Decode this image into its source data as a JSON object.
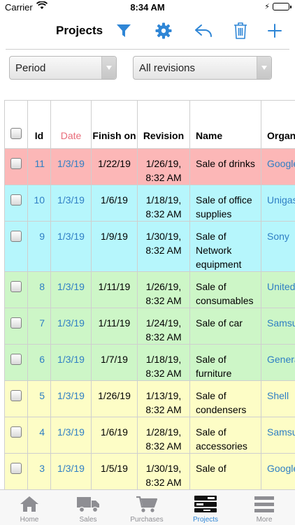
{
  "status": {
    "carrier": "Carrier",
    "time": "8:34 AM"
  },
  "nav": {
    "title": "Projects"
  },
  "filters": {
    "period": "Period",
    "revisions": "All revisions"
  },
  "table": {
    "headers": {
      "id": "Id",
      "date": "Date",
      "finish": "Finish on",
      "revision": "Revision",
      "name": "Name",
      "organization": "Organ"
    },
    "rows": [
      {
        "id": "11",
        "date": "1/3/19",
        "finish": "1/22/19",
        "revision": "1/26/19, 8:32 AM",
        "name": "Sale of drinks",
        "organization": "Google",
        "color": "#fcb7b7"
      },
      {
        "id": "10",
        "date": "1/3/19",
        "finish": "1/6/19",
        "revision": "1/18/19, 8:32 AM",
        "name": "Sale of office supplies",
        "organization": "Unigas",
        "color": "#b6f6fc"
      },
      {
        "id": "9",
        "date": "1/3/19",
        "finish": "1/9/19",
        "revision": "1/30/19, 8:32 AM",
        "name": "Sale of Network equipment",
        "organization": "Sony",
        "color": "#b6f6fc"
      },
      {
        "id": "8",
        "date": "1/3/19",
        "finish": "1/11/19",
        "revision": "1/26/19, 8:32 AM",
        "name": "Sale of consumables",
        "organization": "United",
        "color": "#cdf6c7"
      },
      {
        "id": "7",
        "date": "1/3/19",
        "finish": "1/11/19",
        "revision": "1/24/19, 8:32 AM",
        "name": "Sale of car",
        "organization": "Samsu",
        "color": "#cdf6c7"
      },
      {
        "id": "6",
        "date": "1/3/19",
        "finish": "1/7/19",
        "revision": "1/18/19, 8:32 AM",
        "name": "Sale of furniture",
        "organization": "General motors",
        "color": "#cdf6c7"
      },
      {
        "id": "5",
        "date": "1/3/19",
        "finish": "1/26/19",
        "revision": "1/13/19, 8:32 AM",
        "name": "Sale of condensers",
        "organization": "Shell",
        "color": "#fdfdc6"
      },
      {
        "id": "4",
        "date": "1/3/19",
        "finish": "1/6/19",
        "revision": "1/28/19, 8:32 AM",
        "name": "Sale of accessories",
        "organization": "Samsu",
        "color": "#fdfdc6"
      },
      {
        "id": "3",
        "date": "1/3/19",
        "finish": "1/5/19",
        "revision": "1/30/19, 8:32 AM",
        "name": "Sale of",
        "organization": "Google",
        "color": "#fdfdc6"
      }
    ]
  },
  "tabs": [
    {
      "label": "Home",
      "icon": "home-icon"
    },
    {
      "label": "Sales",
      "icon": "truck-icon"
    },
    {
      "label": "Purchases",
      "icon": "cart-icon"
    },
    {
      "label": "Projects",
      "icon": "projects-icon",
      "active": true
    },
    {
      "label": "More",
      "icon": "menu-icon"
    }
  ],
  "colors": {
    "accent": "#2f86d6",
    "link": "#2e7ec4",
    "date_header": "#e86c7a"
  }
}
